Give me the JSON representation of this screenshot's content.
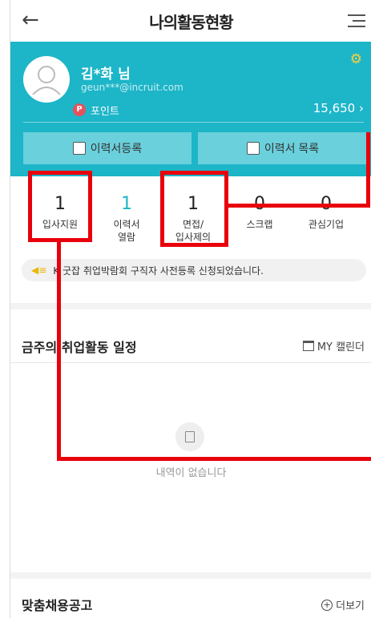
{
  "header": {
    "back_icon": "arrow-left-icon",
    "title": "나의활동현황",
    "menu_icon": "hamburger-menu-icon"
  },
  "profile": {
    "name": "김*화 님",
    "email": "geun***@incruit.com",
    "settings_icon": "gear-icon",
    "point_badge": "P",
    "point_label": "포인트",
    "point_value": "15,650 ›",
    "register_button": "이력서등록",
    "list_button": "이력서 목록",
    "accent_color": "#1db5c8"
  },
  "stats": [
    {
      "value": "1",
      "label": "입사지원"
    },
    {
      "value": "1",
      "label": "이력서\n열람"
    },
    {
      "value": "1",
      "label": "면접/\n입사제의"
    },
    {
      "value": "0",
      "label": "스크랩"
    },
    {
      "value": "0",
      "label": "관심기업"
    }
  ],
  "notice": {
    "icon": "speaker-icon",
    "text": "K 굿잡 취업박람회 구직자 사전등록 신청되었습니다."
  },
  "schedule": {
    "title": "금주의 취업활동 일정",
    "calendar_link": "MY 캘린더",
    "empty_text": "내역이 없습니다"
  },
  "recommend": {
    "title": "맞춤채용공고",
    "more_link": "더보기"
  },
  "annotation_color": "#e8000b"
}
